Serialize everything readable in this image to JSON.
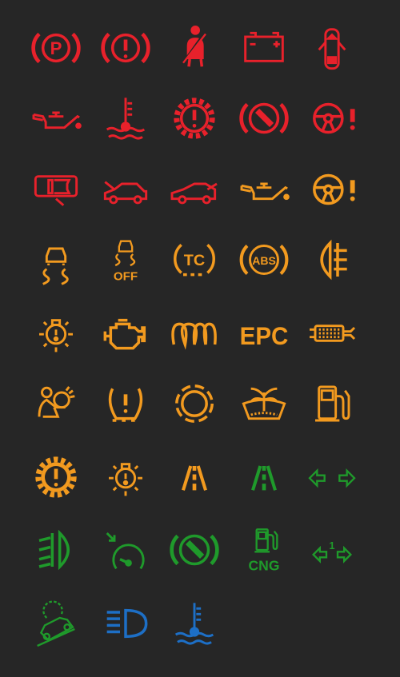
{
  "colors": {
    "background": "#262626",
    "red": "#e8212b",
    "amber": "#f29a1f",
    "green": "#1f9a2b",
    "blue": "#1d6fc6"
  },
  "labels": {
    "parking": "P",
    "stability_off": "OFF",
    "traction": "TC",
    "abs": "ABS",
    "epc": "EPC",
    "cng": "CNG",
    "lane_number": "1"
  },
  "icons": [
    {
      "name": "parking-brake",
      "color": "red"
    },
    {
      "name": "brake-system-warning",
      "color": "red"
    },
    {
      "name": "seatbelt",
      "color": "red"
    },
    {
      "name": "battery",
      "color": "red"
    },
    {
      "name": "door-open",
      "color": "red"
    },
    {
      "name": "oil-pressure",
      "color": "red"
    },
    {
      "name": "coolant-temperature",
      "color": "red"
    },
    {
      "name": "transmission-warning",
      "color": "red"
    },
    {
      "name": "electric-parking-brake",
      "color": "red"
    },
    {
      "name": "power-steering-warning",
      "color": "red"
    },
    {
      "name": "display-warning",
      "color": "red"
    },
    {
      "name": "hood-open",
      "color": "red"
    },
    {
      "name": "trunk-open",
      "color": "red"
    },
    {
      "name": "oil-level",
      "color": "amber"
    },
    {
      "name": "steering-fault",
      "color": "amber"
    },
    {
      "name": "stability-control",
      "color": "amber"
    },
    {
      "name": "stability-control-off",
      "color": "amber"
    },
    {
      "name": "traction-control",
      "color": "amber"
    },
    {
      "name": "abs",
      "color": "amber"
    },
    {
      "name": "rear-fog-light",
      "color": "amber"
    },
    {
      "name": "bulb-failure",
      "color": "amber"
    },
    {
      "name": "check-engine",
      "color": "amber"
    },
    {
      "name": "glow-plug",
      "color": "amber"
    },
    {
      "name": "epc",
      "color": "amber"
    },
    {
      "name": "diesel-particulate-filter",
      "color": "amber"
    },
    {
      "name": "airbag",
      "color": "amber"
    },
    {
      "name": "tire-pressure",
      "color": "amber"
    },
    {
      "name": "brake-pad-wear",
      "color": "amber"
    },
    {
      "name": "washer-fluid",
      "color": "amber"
    },
    {
      "name": "low-fuel",
      "color": "amber"
    },
    {
      "name": "transmission-fault",
      "color": "amber"
    },
    {
      "name": "exterior-light-fault",
      "color": "amber"
    },
    {
      "name": "lane-assist-fault",
      "color": "amber"
    },
    {
      "name": "lane-assist-active",
      "color": "green"
    },
    {
      "name": "turn-signals",
      "color": "green"
    },
    {
      "name": "front-fog-light",
      "color": "green"
    },
    {
      "name": "cruise-control",
      "color": "green"
    },
    {
      "name": "parking-brake-active",
      "color": "green"
    },
    {
      "name": "cng-fuel",
      "color": "green"
    },
    {
      "name": "turn-signals-trailer",
      "color": "green"
    },
    {
      "name": "hill-descent-control",
      "color": "green"
    },
    {
      "name": "high-beam",
      "color": "blue"
    },
    {
      "name": "coolant-low-temperature",
      "color": "blue"
    }
  ]
}
